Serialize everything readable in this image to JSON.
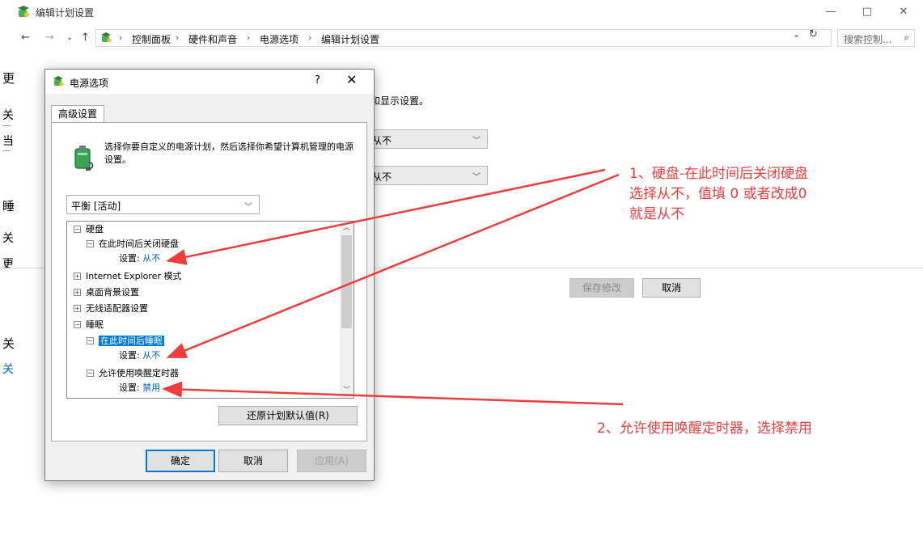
{
  "window": {
    "title": "编辑计划设置",
    "controls": {
      "minimize": "—",
      "maximize": "□",
      "close": "✕"
    }
  },
  "nav": {
    "back": "←",
    "forward": "→",
    "recent": "⌄",
    "up": "↑"
  },
  "address": {
    "crumbs": [
      "控制面板",
      "硬件和声音",
      "电源选项",
      "编辑计划设置"
    ],
    "separator": "›",
    "dropdown": "⌄",
    "refresh": "↻"
  },
  "search": {
    "placeholder": "搜索控制...",
    "icon": "⌕"
  },
  "background": {
    "partial_text": "和显示设置。",
    "select1": "从不",
    "select2": "从不",
    "save_button": "保存修改",
    "cancel_button": "取消",
    "edge_fragments": [
      "更",
      "关",
      "当",
      "关",
      "睡",
      "关",
      "更",
      "关",
      "关"
    ]
  },
  "dialog": {
    "title": "电源选项",
    "help": "?",
    "close": "✕",
    "tab": "高级设置",
    "description": "选择你要自定义的电源计划，然后选择你希望计算机管理的电源设置。",
    "plan": "平衡 [活动]",
    "setting_label": "设置:",
    "tree": {
      "disk": "硬盘",
      "disk_off": "在此时间后关闭硬盘",
      "disk_off_value": "从不",
      "ie": "Internet Explorer 模式",
      "desktop_bg": "桌面背景设置",
      "wireless": "无线适配器设置",
      "sleep": "睡眠",
      "sleep_after": "在此时间后睡眠",
      "sleep_after_value": "从不",
      "wake_timers": "允许使用唤醒定时器",
      "wake_timers_value": "禁用"
    },
    "restore_button": "还原计划默认值(R)",
    "ok_button": "确定",
    "cancel_button": "取消",
    "apply_button": "应用(A)"
  },
  "annotations": {
    "note1_line1": "1、硬盘-在此时间后关闭硬盘",
    "note1_line2": "选择从不，值填 0 或者改成0",
    "note1_line3": "就是从不",
    "note2": "2、允许使用唤醒定时器，选择禁用",
    "color": "#f03c3c"
  }
}
